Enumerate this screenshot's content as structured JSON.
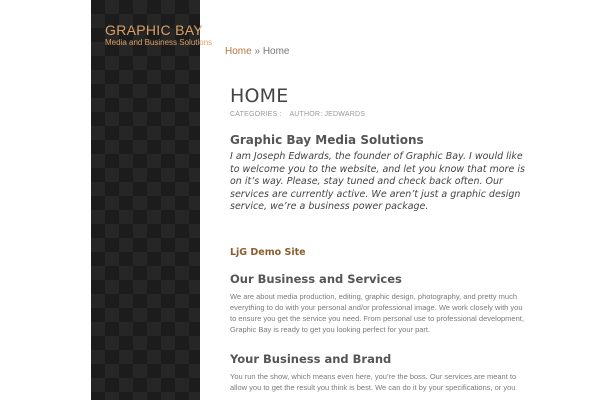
{
  "site": {
    "title": "GRAPHIC BAY",
    "tagline": "Media and Business Solutions"
  },
  "breadcrumb": {
    "home_link": "Home",
    "separator": "»",
    "current": "Home"
  },
  "page": {
    "title": "HOME",
    "meta": {
      "categories": "CATEGORIES :",
      "author": "AUTHOR: JEDWARDS"
    }
  },
  "article": {
    "heading": "Graphic Bay Media Solutions",
    "intro": "I am Joseph Edwards, the founder of Graphic Bay. I would like to welcome you to the website, and let you know that more is on it’s way. Please, stay tuned and check back often. Our services are currently active. We aren’t just a graphic design service, we’re a business power package.",
    "demo_link": "LjG Demo Site",
    "sections": [
      {
        "heading": "Our Business and Services",
        "text": "We are about media production, editing, graphic design, photography, and pretty much everything to do with your personal and/or professional image. We work closely with you to ensure you get the service you need. From personal use to professional development, Graphic Bay is ready to get you looking perfect for your part."
      },
      {
        "heading": "Your Business and Brand",
        "text": "You run the show, which means even here, you’re the boss. Our services are meant to allow you to get the result you think is best. We can do it by your specifications, or you"
      }
    ]
  },
  "colors": {
    "sidebar_bg": "#1c1c1c",
    "accent": "#d9a066",
    "link": "#b5753d",
    "demo_link": "#8b5e2e"
  }
}
